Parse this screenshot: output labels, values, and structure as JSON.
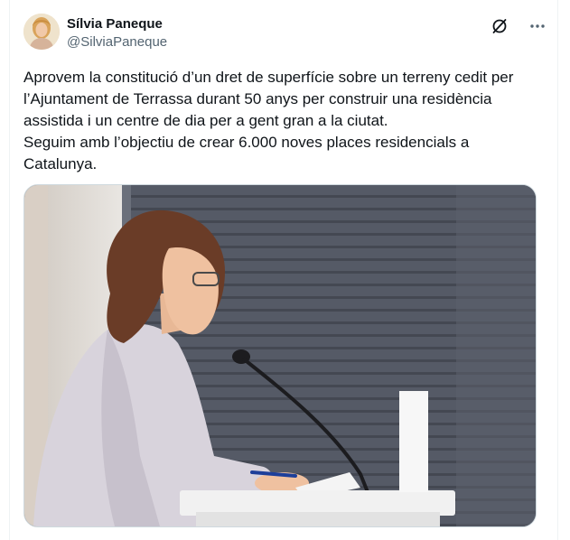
{
  "author": {
    "display_name": "Sílvia Paneque",
    "handle": "@SilviaPaneque"
  },
  "tweet": {
    "paragraph_1": "Aprovem la constitució d’un dret de superfície sobre un terreny cedit per l’Ajuntament de Terrassa durant 50 anys per construir una residència assistida i un centre de dia per a gent gran a la ciutat.",
    "paragraph_2": "Seguim amb l’objectiu de crear 6.000 noves places residencials a Catalunya."
  },
  "icons": {
    "grok": "grok-icon",
    "more": "more-icon"
  },
  "colors": {
    "text": "#0f1419",
    "secondary": "#536471",
    "border": "#cfd9de"
  }
}
